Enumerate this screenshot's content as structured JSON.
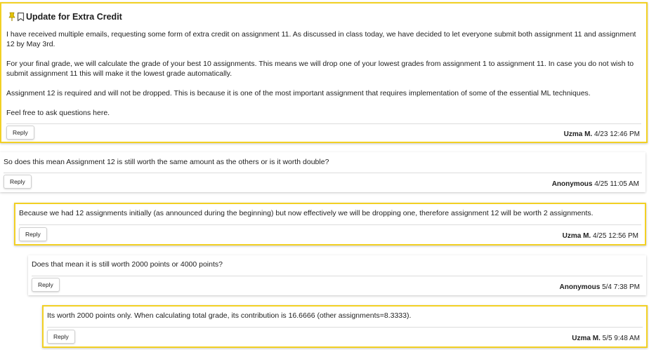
{
  "colors": {
    "instructor_border": "#f2d024",
    "pin_icon": "#e5c400"
  },
  "icons": [
    "pin-icon",
    "bookmark-icon"
  ],
  "thread": {
    "title": "Update for Extra Credit",
    "paragraphs": [
      "I have received multiple emails, requesting some form of extra credit on assignment 11. As discussed in class today, we have decided to let everyone submit both assignment 11 and assignment 12 by May 3rd.",
      "For your final grade, we will calculate the grade of your best 10 assignments. This means we will drop one of your lowest grades from assignment 1 to assignment 11. In case you do not wish to submit assignment 11 this will make it the lowest grade automatically.",
      "Assignment 12 is required and will not be dropped. This is because it is one of the most important assignment that requires implementation of some of the essential ML techniques.",
      "Feel free to ask questions here."
    ],
    "reply_label": "Reply",
    "author": "Uzma M.",
    "timestamp": "4/23 12:46 PM"
  },
  "replies": [
    {
      "text": "So does this mean Assignment 12 is still worth the same amount as the others or is it worth double?",
      "reply_label": "Reply",
      "author": "Anonymous",
      "timestamp": "4/25 11:05 AM"
    },
    {
      "text": "Because we had 12 assignments initially (as announced during the beginning) but now effectively we will be dropping one, therefore assignment 12 will be worth 2 assignments.",
      "reply_label": "Reply",
      "author": "Uzma M.",
      "timestamp": "4/25 12:56 PM"
    },
    {
      "text": "Does that mean it is still worth 2000 points or 4000 points?",
      "reply_label": "Reply",
      "author": "Anonymous",
      "timestamp": "5/4 7:38 PM"
    },
    {
      "text": "Its worth 2000 points only. When calculating total grade, its contribution is 16.6666 (other assignments=8.3333).",
      "reply_label": "Reply",
      "author": "Uzma M.",
      "timestamp": "5/5 9:48 AM"
    }
  ]
}
